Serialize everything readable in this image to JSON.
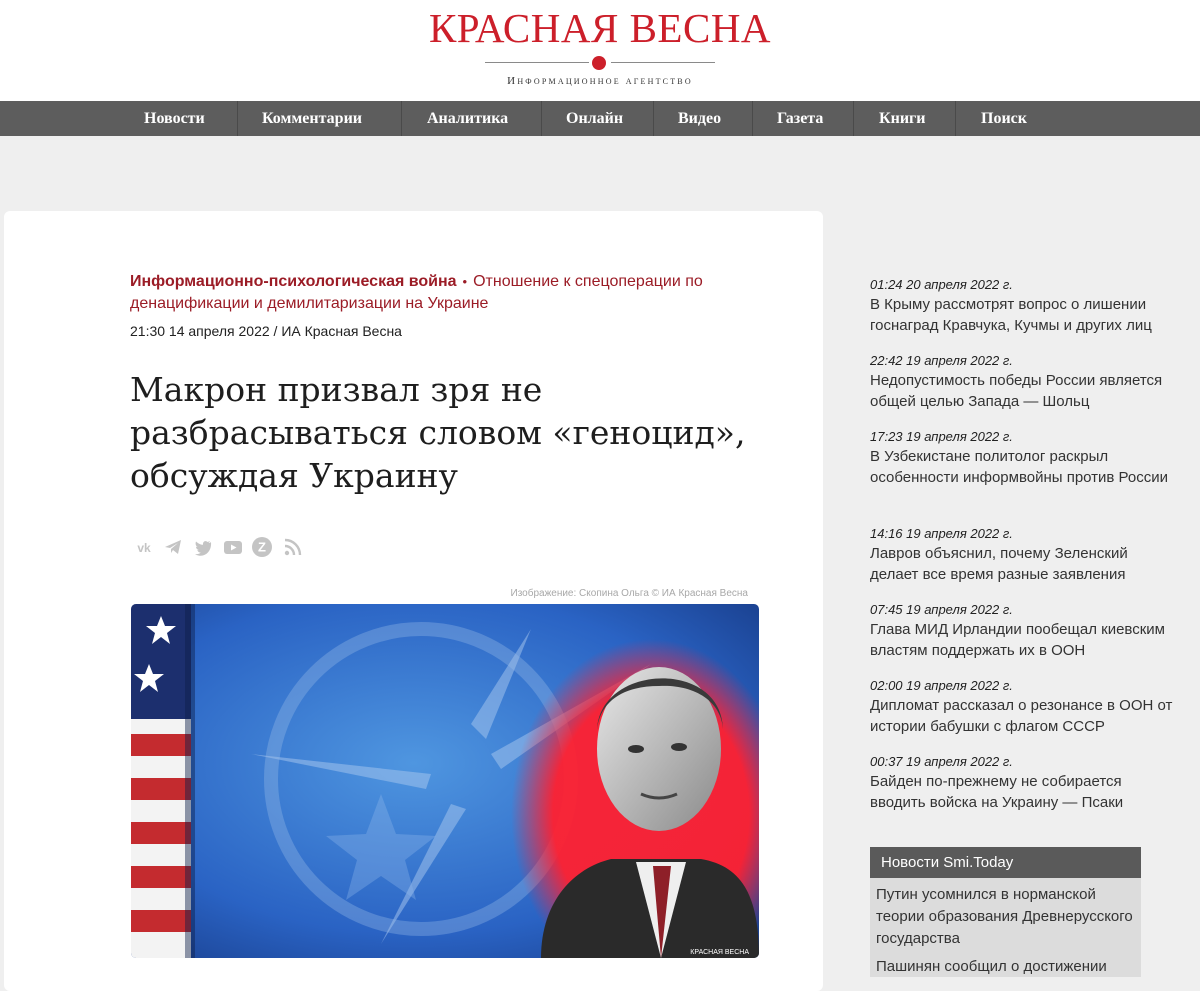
{
  "masthead": {
    "title": "КРАСНАЯ ВЕСНА",
    "subtitle": "Информационное агентство",
    "brand_color": "#cc1f2a"
  },
  "nav": {
    "items": [
      "Новости",
      "Комментарии",
      "Аналитика",
      "Онлайн",
      "Видео",
      "Газета",
      "Книги",
      "Поиск"
    ]
  },
  "article": {
    "rubric_main": "Информационно-психологическая война",
    "rubric_bullet": "•",
    "rubric_sub": "Отношение к спецоперации по денацификации и демилитаризации на Украине",
    "meta": "21:30  14 апреля 2022 / ИА Красная Весна",
    "headline": "Макрон призвал зря не разбрасываться словом «геноцид», обсуждая Украину",
    "share_icons": [
      "vk-icon",
      "telegram-icon",
      "twitter-icon",
      "youtube-icon",
      "livejournal-icon",
      "rss-icon"
    ],
    "image_credit": "Изображение: Скопина Ольга © ИА Красная Весна",
    "image_watermark": "КРАСНАЯ ВЕСНА"
  },
  "sidebar": {
    "news": [
      {
        "time": "01:24  20 апреля 2022 г.",
        "text": "В Крыму рассмотрят вопрос о лишении госнаград Кравчука, Кучмы и других лиц"
      },
      {
        "time": "22:42  19 апреля 2022 г.",
        "text": "Недопустимость победы России является общей целью Запада — Шольц"
      },
      {
        "time": "17:23  19 апреля 2022 г.",
        "text": "В Узбекистане политолог раскрыл особенности информвойны против России"
      },
      {
        "time": "14:16  19 апреля 2022 г.",
        "text": "Лавров объяснил, почему Зеленский делает все время разные заявления"
      },
      {
        "time": "07:45  19 апреля 2022 г.",
        "text": "Глава МИД Ирландии пообещал киевским властям поддержать их в ООН"
      },
      {
        "time": "02:00  19 апреля 2022 г.",
        "text": "Дипломат рассказал о резонансе в ООН от истории бабушки с флагом СССР"
      },
      {
        "time": "00:37  19 апреля 2022 г.",
        "text": "Байден по-прежнему не собирается вводить войска на Украину — Псаки"
      }
    ],
    "smi_title": "Новости Smi.Today",
    "smi_items": [
      "Путин усомнился в норманской теории образования Древнерусского государства",
      "Пашинян сообщил о достижении"
    ]
  }
}
